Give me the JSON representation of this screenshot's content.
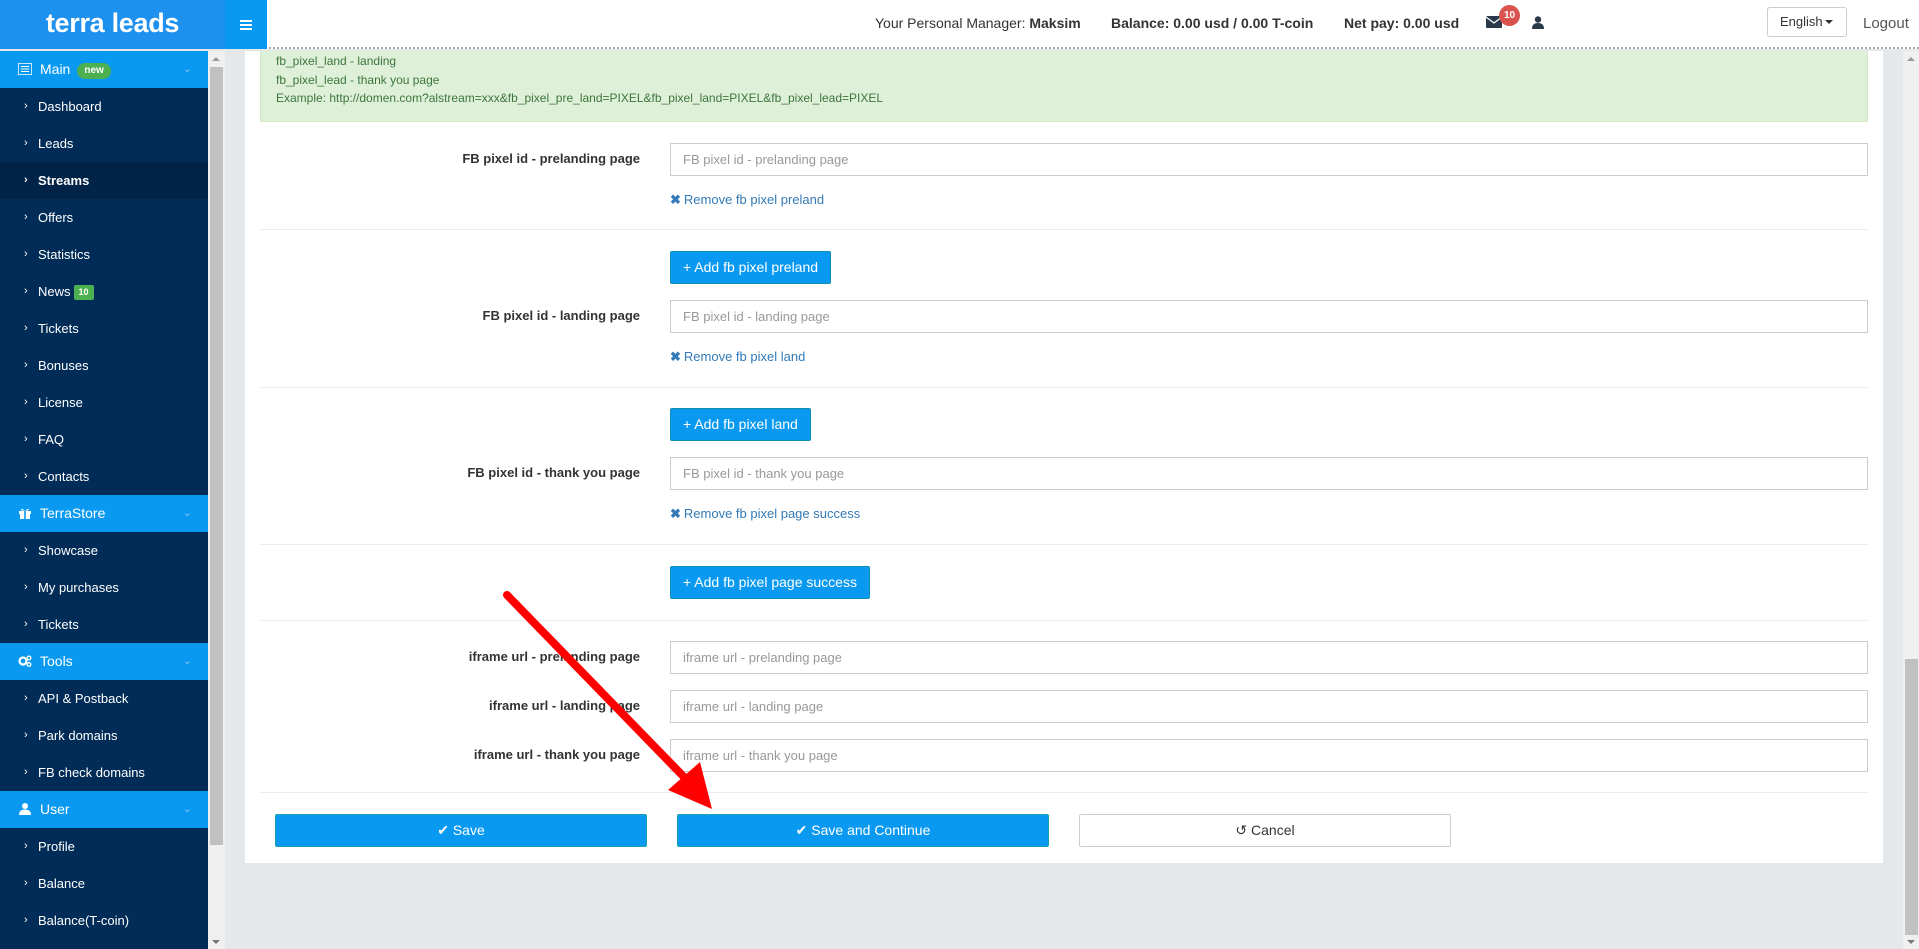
{
  "header": {
    "logo": "terra leads",
    "manager_label": "Your Personal Manager:",
    "manager_name": "Maksim",
    "balance": "Balance: 0.00 usd / 0.00 T-coin",
    "net_pay": "Net pay: 0.00 usd",
    "mail_count": "10",
    "language": "English",
    "logout": "Logout"
  },
  "sidebar": {
    "sections": [
      {
        "label": "Main",
        "badge": "new",
        "items": [
          {
            "label": "Dashboard"
          },
          {
            "label": "Leads"
          },
          {
            "label": "Streams",
            "active": true
          },
          {
            "label": "Offers"
          },
          {
            "label": "Statistics"
          },
          {
            "label": "News",
            "badge": "10"
          },
          {
            "label": "Tickets"
          },
          {
            "label": "Bonuses"
          },
          {
            "label": "License"
          },
          {
            "label": "FAQ"
          },
          {
            "label": "Contacts"
          }
        ]
      },
      {
        "label": "TerraStore",
        "items": [
          {
            "label": "Showcase"
          },
          {
            "label": "My purchases"
          },
          {
            "label": "Tickets"
          }
        ]
      },
      {
        "label": "Tools",
        "items": [
          {
            "label": "API & Postback"
          },
          {
            "label": "Park domains"
          },
          {
            "label": "FB check domains"
          }
        ]
      },
      {
        "label": "User",
        "items": [
          {
            "label": "Profile"
          },
          {
            "label": "Balance"
          },
          {
            "label": "Balance(T-coin)"
          }
        ]
      }
    ]
  },
  "info": {
    "lines": [
      "fb_pixel_land - landing",
      "fb_pixel_lead - thank you page",
      "Example: http://domen.com?alstream=xxx&fb_pixel_pre_land=PIXEL&fb_pixel_land=PIXEL&fb_pixel_lead=PIXEL"
    ]
  },
  "form": {
    "pixel_preland": {
      "label": "FB pixel id - prelanding page",
      "placeholder": "FB pixel id - prelanding page",
      "value": "",
      "remove": "Remove fb pixel preland"
    },
    "add_preland": "+ Add fb pixel preland",
    "pixel_land": {
      "label": "FB pixel id - landing page",
      "placeholder": "FB pixel id - landing page",
      "value": "",
      "remove": "Remove fb pixel land"
    },
    "add_land": "+ Add fb pixel land",
    "pixel_success": {
      "label": "FB pixel id - thank you page",
      "placeholder": "FB pixel id - thank you page",
      "value": "",
      "remove": "Remove fb pixel page success"
    },
    "add_success": "+ Add fb pixel page success",
    "iframe_preland": {
      "label": "iframe url - prelanding page",
      "placeholder": "iframe url - prelanding page",
      "value": ""
    },
    "iframe_land": {
      "label": "iframe url - landing page",
      "placeholder": "iframe url - landing page",
      "value": ""
    },
    "iframe_success": {
      "label": "iframe url - thank you page",
      "placeholder": "iframe url - thank you page",
      "value": ""
    }
  },
  "actions": {
    "save": "Save",
    "save_continue": "Save and Continue",
    "cancel": "Cancel"
  },
  "colors": {
    "accent": "#0a99f0",
    "sidebar_bg": "#002c57",
    "alert_bg": "#dff0d8",
    "annotation_arrow": "#ff0000"
  }
}
